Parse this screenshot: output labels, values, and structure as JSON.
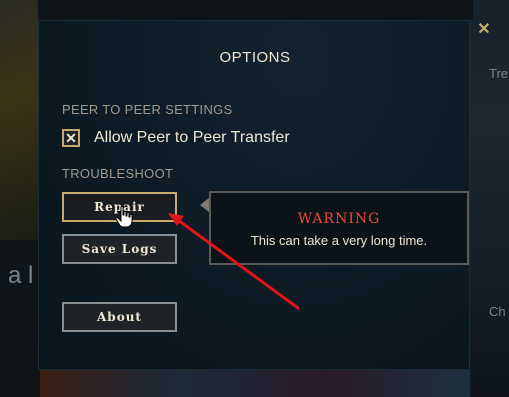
{
  "background": {
    "left_text": "a l",
    "right_text_1": "Tre",
    "right_text_2": "Ch"
  },
  "options_dialog": {
    "title": "OPTIONS",
    "close_icon": "close-x-icon",
    "peer_to_peer": {
      "section_label": "PEER TO PEER SETTINGS",
      "allow_transfer_label": "Allow Peer to Peer Transfer",
      "allow_transfer_checked": true
    },
    "troubleshoot": {
      "section_label": "TROUBLESHOOT",
      "repair_label": "Repair",
      "save_logs_label": "Save Logs"
    },
    "about_label": "About",
    "warning": {
      "title": "WARNING",
      "text": "This can take a very long time."
    }
  },
  "colors": {
    "gold_accent": "#c8aa6e",
    "text_light": "#f0e6d2",
    "warning_red": "#e84a3c",
    "annotation_arrow": "#e0131b"
  }
}
